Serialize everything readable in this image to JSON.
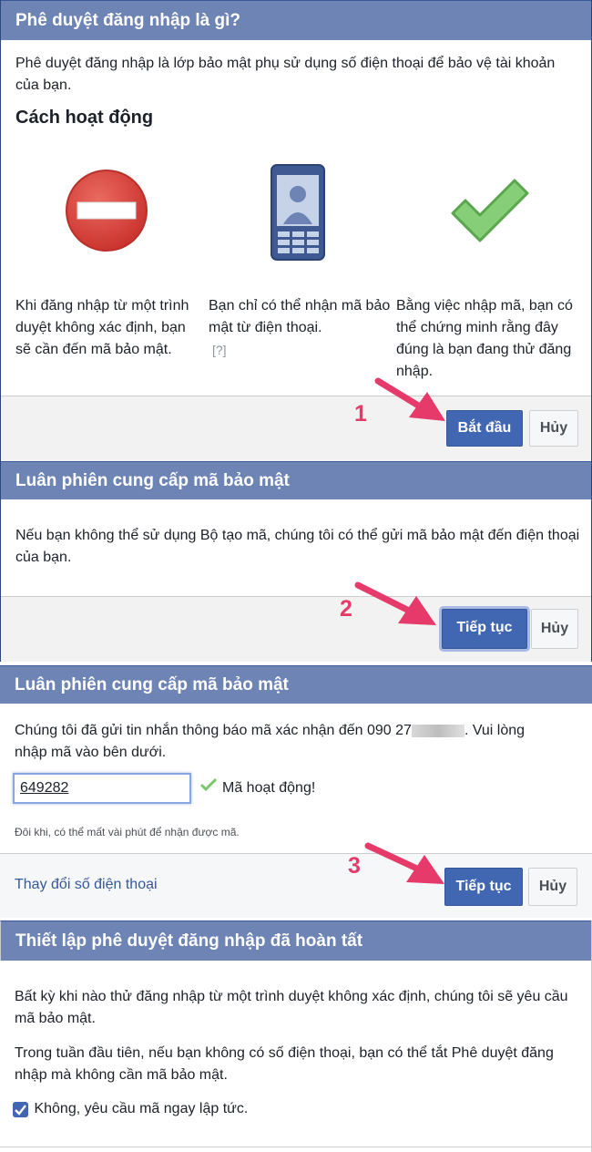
{
  "panel1": {
    "title": "Phê duyệt đăng nhập là gì?",
    "description": "Phê duyệt đăng nhập là lớp bảo mật phụ sử dụng số điện thoại để bảo vệ tài khoản của bạn.",
    "how_title": "Cách hoạt động",
    "columns": [
      {
        "text": "Khi đăng nhập từ một trình duyệt không xác định, bạn sẽ cần đến mã bảo mật.",
        "icon": "no-entry-icon"
      },
      {
        "text": "Bạn chỉ có thể nhận mã bảo mật từ điện thoại.",
        "help": "[?]",
        "icon": "phone-icon"
      },
      {
        "text": "Bằng việc nhập mã, bạn có thể chứng minh rằng đây đúng là bạn đang thử đăng nhập.",
        "icon": "checkmark-icon"
      }
    ],
    "step": "1",
    "primary": "Bắt đầu",
    "cancel": "Hủy"
  },
  "panel2": {
    "title": "Luân phiên cung cấp mã bảo mật",
    "description": "Nếu bạn không thể sử dụng Bộ tạo mã, chúng tôi có thể gửi mã bảo mật đến điện thoại của bạn.",
    "step": "2",
    "primary": "Tiếp tục",
    "cancel": "Hủy"
  },
  "panel3": {
    "title": "Luân phiên cung cấp mã bảo mật",
    "desc_before": "Chúng tôi đã gửi tin nhắn thông báo mã xác nhận đến 090 27",
    "desc_after": ". Vui lòng nhập mã vào bên dưới.",
    "code_value": "649282",
    "code_status": "Mã hoạt động!",
    "note": "Đôi khi, có thể mất vài phút để nhận được mã.",
    "change_phone": "Thay đổi số điện thoại",
    "step": "3",
    "primary": "Tiếp tục",
    "cancel": "Hủy"
  },
  "panel4": {
    "title": "Thiết lập phê duyệt đăng nhập đã hoàn tất",
    "para1": "Bất kỳ khi nào thử đăng nhập từ một trình duyệt không xác định, chúng tôi sẽ yêu cầu mã bảo mật.",
    "para2": "Trong tuần đầu tiên, nếu bạn không có số điện thoại, bạn có thể tắt Phê duyệt đăng nhập mà không cần mã bảo mật.",
    "checkbox_label": "Không, yêu cầu mã ngay lập tức.",
    "checkbox_checked": true
  },
  "colors": {
    "header": "#6d84b4",
    "primary": "#4267b2",
    "arrow": "#e63b6a",
    "check": "#7bc86c",
    "stop": "#d9413e"
  }
}
